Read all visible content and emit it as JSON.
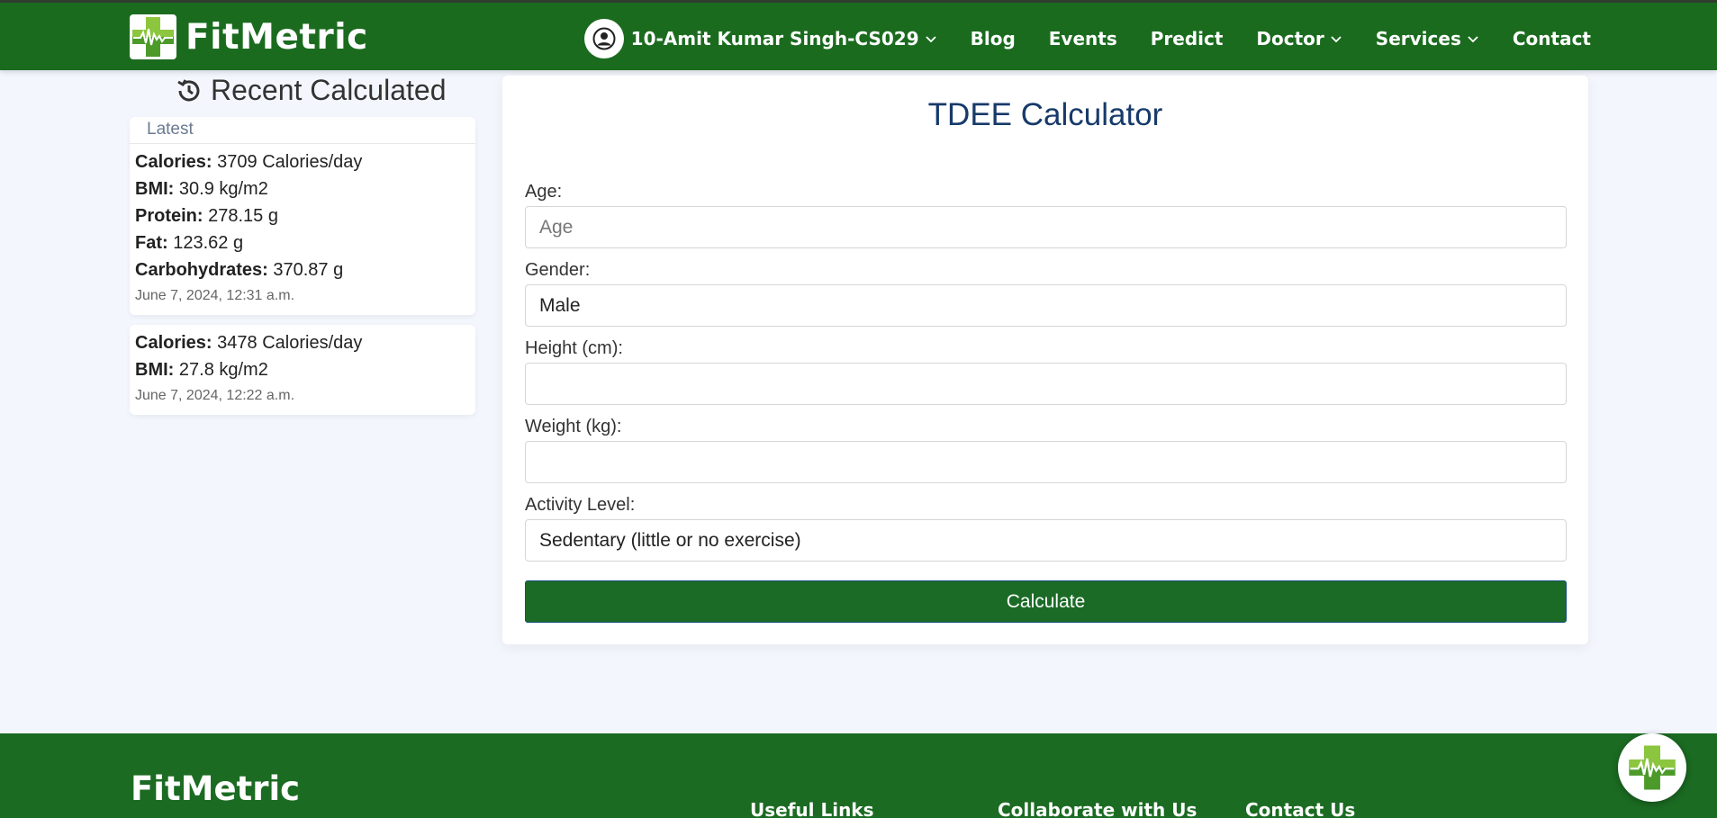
{
  "brand": {
    "name": "FitMetric",
    "logo_icon": "medical-cross-heartbeat-icon"
  },
  "nav": {
    "user_label": "10-Amit Kumar Singh-CS029",
    "items": [
      "Blog",
      "Events",
      "Predict",
      "Doctor",
      "Services",
      "Contact"
    ]
  },
  "sidebar": {
    "title": "Recent Calculated",
    "latest_label": "Latest",
    "cards": [
      {
        "rows": [
          {
            "k": "Calories:",
            "v": "3709 Calories/day"
          },
          {
            "k": "BMI:",
            "v": "30.9 kg/m2"
          },
          {
            "k": "Protein:",
            "v": "278.15 g"
          },
          {
            "k": "Fat:",
            "v": "123.62 g"
          },
          {
            "k": "Carbohydrates:",
            "v": "370.87 g"
          }
        ],
        "timestamp": "June 7, 2024, 12:31 a.m."
      },
      {
        "rows": [
          {
            "k": "Calories:",
            "v": "3478 Calories/day"
          },
          {
            "k": "BMI:",
            "v": "27.8 kg/m2"
          }
        ],
        "timestamp": "June 7, 2024, 12:22 a.m."
      }
    ]
  },
  "form": {
    "title": "TDEE Calculator",
    "age_label": "Age:",
    "age_placeholder": "Age",
    "gender_label": "Gender:",
    "gender_value": "Male",
    "height_label": "Height (cm):",
    "weight_label": "Weight (kg):",
    "activity_label": "Activity Level:",
    "activity_value": "Sedentary (little or no exercise)",
    "submit_label": "Calculate"
  },
  "footer": {
    "brand": "FitMetric",
    "headings": [
      "Useful Links",
      "Collaborate with Us",
      "Contact Us"
    ]
  },
  "colors": {
    "primary_green": "#1b6b1f",
    "title_blue": "#173a6a",
    "background": "#f3f7fd"
  }
}
